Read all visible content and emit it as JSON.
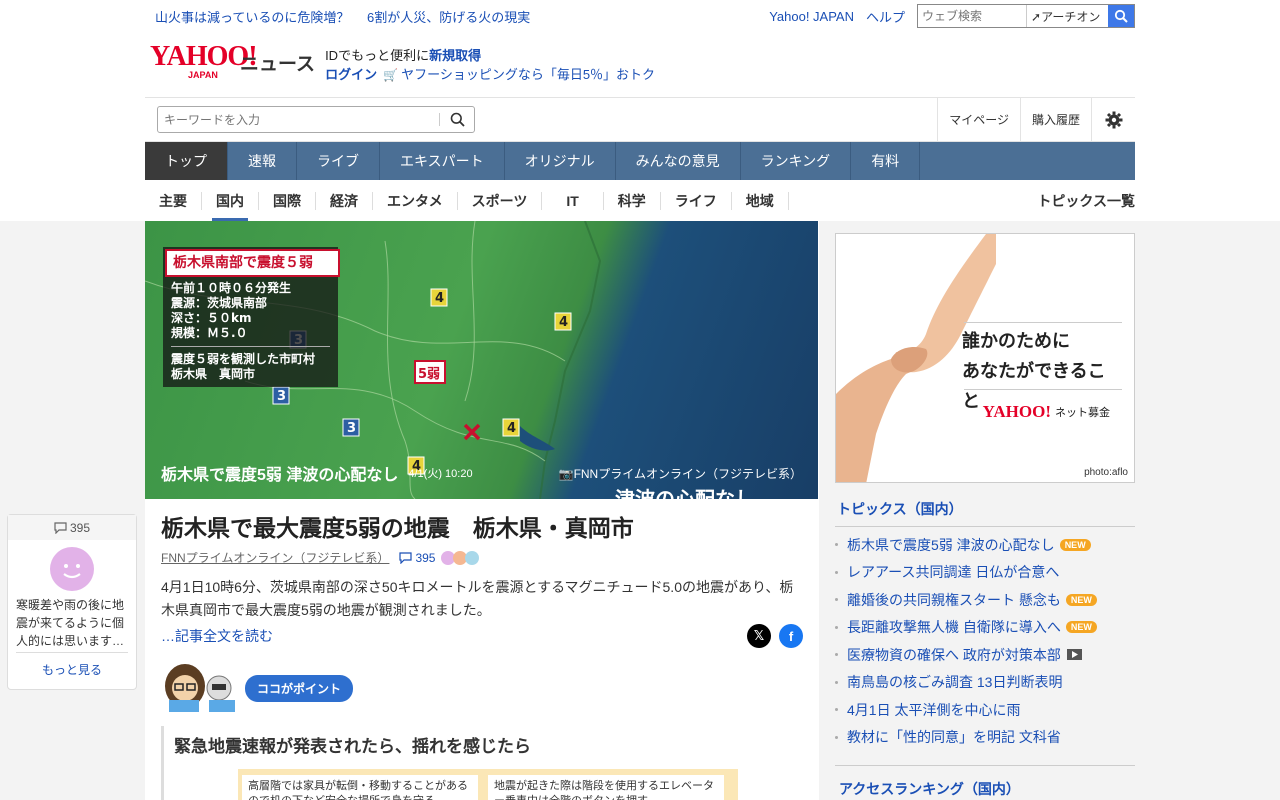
{
  "topbar": {
    "promo1": "山火事は減っているのに危険増？",
    "promo2": "6割が人災、防げる火の現実",
    "yahoo_japan": "Yahoo! JAPAN",
    "help": "ヘルプ",
    "web_search_placeholder": "ウェブ検索",
    "engine": "アーチオン"
  },
  "header": {
    "logo_main": "YAHOO!",
    "logo_sub": "JAPAN",
    "service": "ニュース",
    "id_text": "IDでもっと便利に",
    "signup": "新規取得",
    "login": "ログイン",
    "shopping": "ヤフーショッピングなら「毎日5％」おトク"
  },
  "search": {
    "placeholder": "キーワードを入力",
    "mypage": "マイページ",
    "history": "購入履歴"
  },
  "nav": [
    "トップ",
    "速報",
    "ライブ",
    "エキスパート",
    "オリジナル",
    "みんなの意見",
    "ランキング",
    "有料"
  ],
  "subnav": [
    "主要",
    "国内",
    "国際",
    "経済",
    "エンタメ",
    "スポーツ",
    "IT",
    "科学",
    "ライフ",
    "地域"
  ],
  "subnav_topics": "トピックス一覧",
  "hero": {
    "panel_title": "栃木県南部で震度５弱",
    "panel_lines": [
      "午前１０時０６分発生",
      "震源：茨城県南部",
      "深さ：５０km",
      "規模：Ｍ５.０"
    ],
    "panel_lines2": [
      "震度５弱を観測した市町村",
      "栃木県　真岡市"
    ],
    "intensity_labels": [
      "4",
      "4",
      "3",
      "5弱",
      "3",
      "3",
      "4",
      "4"
    ],
    "caption_title": "栃木県で震度5弱 津波の心配なし",
    "caption_time": "4/1(火) 10:20",
    "caption_source": "FNNプライムオンライン（フジテレビ系）",
    "overlay_text": "津波の心配なし"
  },
  "article": {
    "title": "栃木県で最大震度5弱の地震　栃木県・真岡市",
    "source": "FNNプライムオンライン（フジテレビ系）",
    "comments": "395",
    "lead": "4月1日10時6分、茨城県南部の深さ50キロメートルを震源とするマグニチュード5.0の地震があり、栃木県真岡市で最大震度5弱の地震が観測されました。",
    "read_more": "…記事全文を読む",
    "point_label": "ココがポイント",
    "point_heading": "緊急地震速報が発表されたら、揺れを感じたら",
    "point_card1": "高層階では家具が転倒・移動することがあるので机の下など安全な場所で身を守る",
    "point_card2": "地震が起きた際は階段を使用するエレベーター乗車中は全階のボタンを押す"
  },
  "float_widget": {
    "count": "395",
    "text": "寒暖差や雨の後に地震が来てるように個人的には思います…",
    "more": "もっと見る"
  },
  "ad": {
    "copy1": "誰かのために",
    "copy2": "あなたができること",
    "brand": "YAHOO!",
    "brand_sub": "JAPAN",
    "service": "ネット募金",
    "credit": "photo:aflo"
  },
  "sidebar": {
    "topics_heading": "トピックス（国内）",
    "topics": [
      {
        "text": "栃木県で震度5弱 津波の心配なし",
        "badge": "NEW"
      },
      {
        "text": "レアアース共同調達 日仏が合意へ",
        "badge": ""
      },
      {
        "text": "離婚後の共同親権スタート 懸念も",
        "badge": "NEW"
      },
      {
        "text": "長距離攻撃無人機 自衛隊に導入へ",
        "badge": "NEW"
      },
      {
        "text": "医療物資の確保へ 政府が対策本部",
        "badge": "video"
      },
      {
        "text": "南鳥島の核ごみ調査 13日判断表明",
        "badge": ""
      },
      {
        "text": "4月1日 太平洋側を中心に雨",
        "badge": ""
      },
      {
        "text": "教材に「性的同意」を明記 文科省",
        "badge": ""
      }
    ],
    "ranking_heading": "アクセスランキング（国内）"
  },
  "colors": {
    "nav_blue": "#4b6f95",
    "link_blue": "#1a4fb5",
    "brand_red": "#e40028",
    "new_badge": "#f5a623"
  }
}
